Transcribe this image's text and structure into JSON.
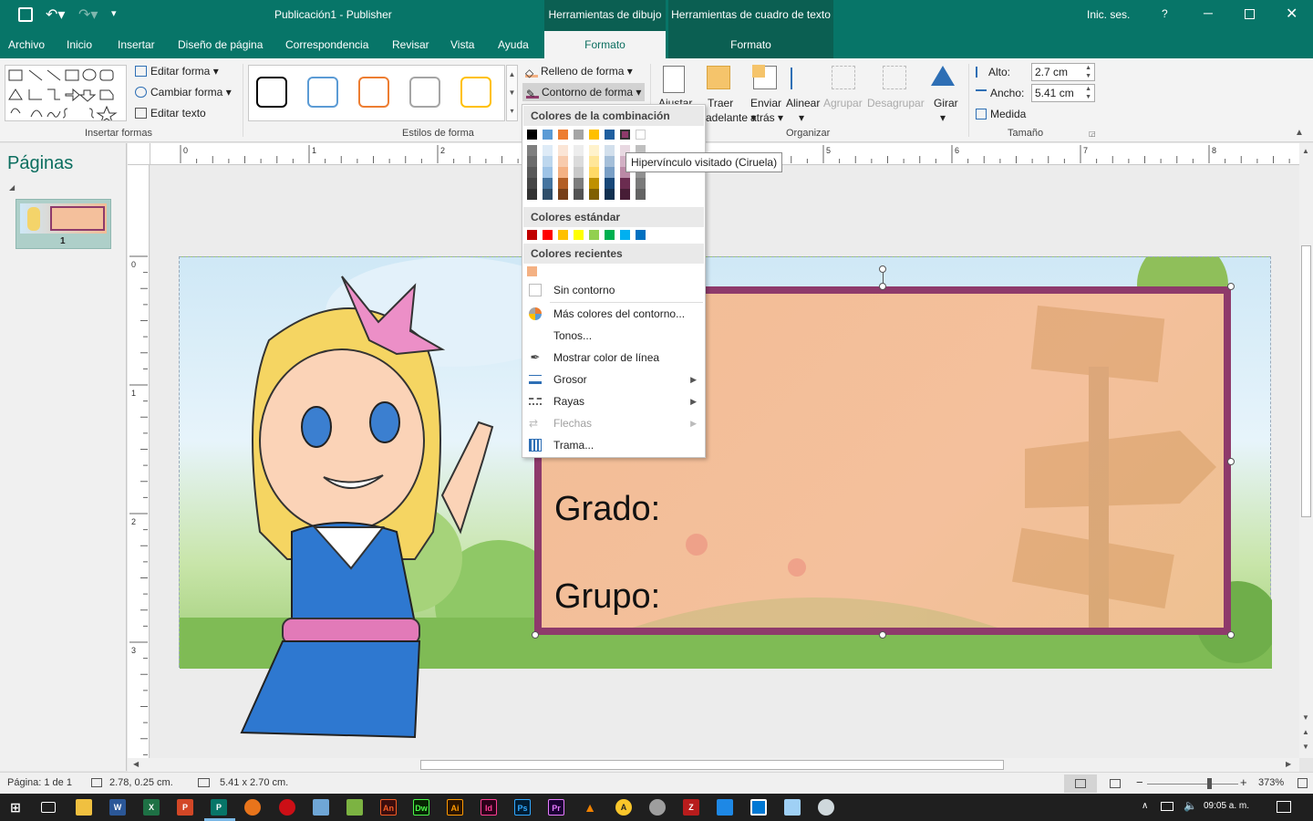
{
  "title": {
    "doc": "Publicación1  -  Publisher",
    "signin": "Inic. ses.",
    "help": "?"
  },
  "tabs": [
    "Archivo",
    "Inicio",
    "Insertar",
    "Diseño de página",
    "Correspondencia",
    "Revisar",
    "Vista",
    "Ayuda"
  ],
  "context": {
    "drawing_header": "Herramientas de dibujo",
    "drawing_tab": "Formato",
    "textbox_header": "Herramientas de cuadro de texto",
    "textbox_tab": "Formato"
  },
  "ribbon": {
    "insert_shapes": {
      "edit_shape": "Editar forma",
      "change_shape": "Cambiar forma",
      "edit_text": "Editar texto",
      "label": "Insertar formas"
    },
    "shape_styles": {
      "label": "Estilos de forma",
      "fill": "Relleno de forma",
      "outline": "Contorno de forma",
      "style_colors": [
        "#000000",
        "#5b9bd5",
        "#ed7d31",
        "#a5a5a5",
        "#ffc000"
      ]
    },
    "arrange": {
      "label": "Organizar",
      "adjust": "Ajustar",
      "bring": "Traer",
      "bring2": "adelante",
      "send": "Enviar",
      "send2": "atrás",
      "align": "Alinear",
      "group": "Agrupar",
      "ungroup": "Desagrupar",
      "rotate": "Girar"
    },
    "size": {
      "label": "Tamaño",
      "height_label": "Alto:",
      "height_value": "2.7 cm",
      "width_label": "Ancho:",
      "width_value": "5.41 cm",
      "measure": "Medida"
    }
  },
  "pages_pane": {
    "title": "Páginas",
    "page_number": "1"
  },
  "ruler": {
    "h_ticks": [
      "0",
      "1",
      "2",
      "3",
      "4",
      "5",
      "6",
      "7",
      "8"
    ],
    "v_ticks": [
      "0",
      "1",
      "2",
      "3"
    ]
  },
  "textbox": {
    "line1": "Grado:",
    "line2": "Grupo:",
    "border_color": "#8e3a6b"
  },
  "menu": {
    "scheme_header": "Colores de la combinación",
    "scheme_colors": [
      "#000000",
      "#5b9bd5",
      "#ed7d31",
      "#a5a5a5",
      "#ffc000",
      "#1f5fa0",
      "#8e3a6b",
      "#ffffff"
    ],
    "standard_header": "Colores estándar",
    "standard_colors": [
      "#c00000",
      "#ff0000",
      "#ffc000",
      "#ffff00",
      "#92d050",
      "#00b050",
      "#00b0f0",
      "#0070c0"
    ],
    "recent_header": "Colores recientes",
    "recent_colors": [
      "#f4b183"
    ],
    "no_outline": "Sin contorno",
    "more_colors": "Más colores del contorno...",
    "tones": "Tonos...",
    "show_line_color": "Mostrar color de línea",
    "weight": "Grosor",
    "dashes": "Rayas",
    "arrows": "Flechas",
    "pattern": "Trama..."
  },
  "tooltip": "Hipervínculo visitado (Ciruela)",
  "status": {
    "page": "Página: 1 de 1",
    "position": "2.78, 0.25 cm.",
    "size": "5.41 x  2.70 cm.",
    "zoom": "373%"
  },
  "taskbar": {
    "time": "09:05 a. m."
  }
}
